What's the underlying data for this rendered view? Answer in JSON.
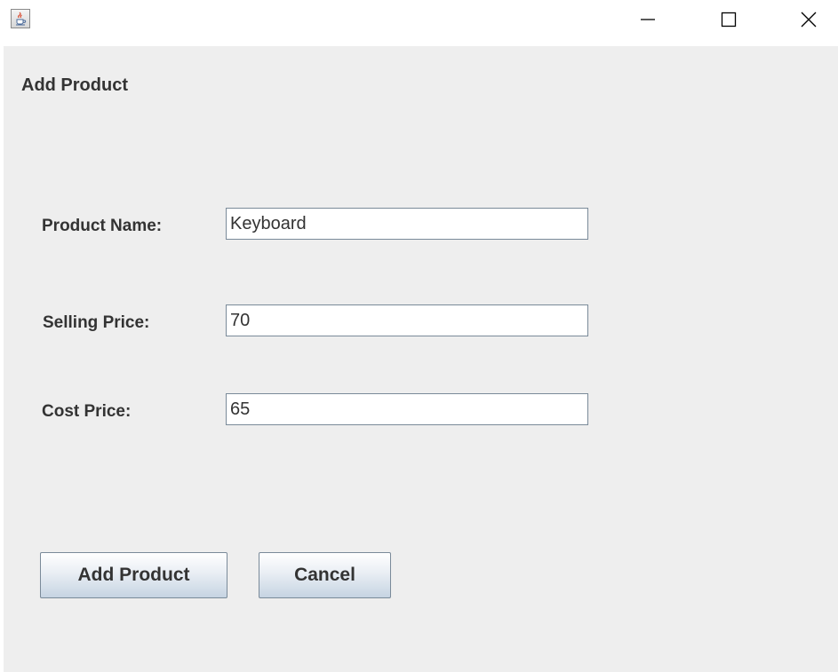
{
  "window": {
    "icon": "java-cup-icon",
    "controls": {
      "minimize": "minimize-icon",
      "maximize": "maximize-icon",
      "close": "close-icon"
    }
  },
  "form": {
    "heading": "Add Product",
    "fields": [
      {
        "label": "Product Name:",
        "value": "Keyboard"
      },
      {
        "label": "Selling Price:",
        "value": "70"
      },
      {
        "label": "Cost Price:",
        "value": "65"
      }
    ],
    "buttons": {
      "add_label": "Add Product",
      "cancel_label": "Cancel"
    }
  },
  "colors": {
    "background": "#eeeeee",
    "field_border": "#7a8a99",
    "text": "#333333"
  }
}
